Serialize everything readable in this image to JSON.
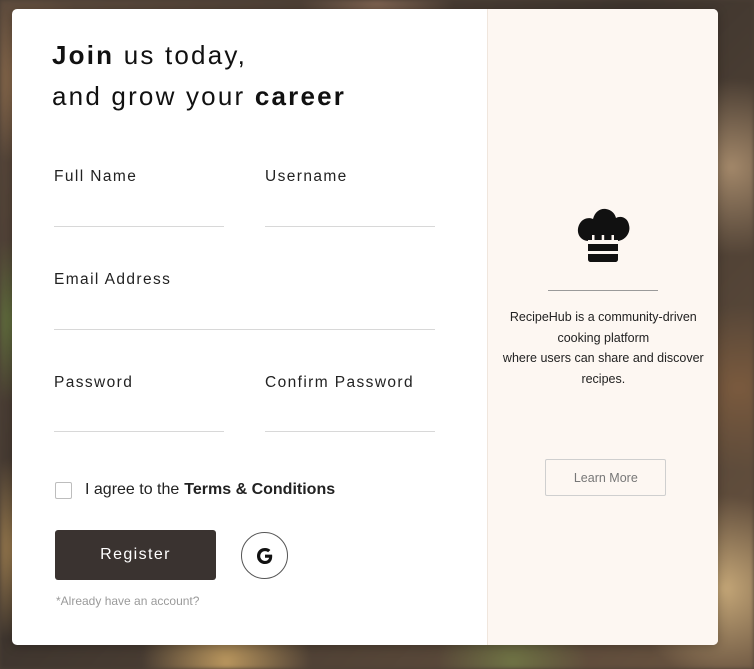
{
  "colors": {
    "button_dark": "#3a3330",
    "info_panel_bg": "#fdf7f2",
    "card_bg": "#ffffff"
  },
  "heading": {
    "line1_bold": "Join",
    "line1_rest": "us today,",
    "line2_rest": "and grow your",
    "line2_bold": "career"
  },
  "form": {
    "full_name": {
      "label": "Full Name",
      "value": ""
    },
    "username": {
      "label": "Username",
      "value": ""
    },
    "email": {
      "label": "Email Address",
      "value": ""
    },
    "password": {
      "label": "Password",
      "value": ""
    },
    "confirm_password": {
      "label": "Confirm Password",
      "value": ""
    },
    "agree_prefix": "I agree to the",
    "agree_terms": "Terms & Conditions",
    "agree_checked": false,
    "register_label": "Register",
    "google_icon": "google-g-icon",
    "google_glyph": "G",
    "already_text": "*Already have an account?"
  },
  "info": {
    "icon": "chef-hat-icon",
    "description_line1": "RecipeHub is a community-driven",
    "description_line2": "cooking platform",
    "description_line3": "where users can share and discover",
    "description_line4": "recipes.",
    "learn_more_label": "Learn More"
  }
}
